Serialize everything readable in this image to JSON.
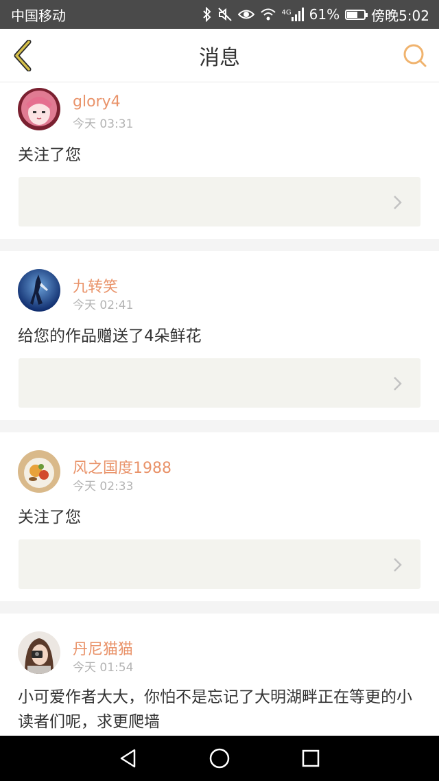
{
  "status_bar": {
    "carrier": "中国移动",
    "network": "4G",
    "battery": "61%",
    "battery_level": 0.61,
    "time": "傍晚5:02",
    "icons": [
      "bluetooth-icon",
      "mute-icon",
      "eye-icon",
      "wifi-icon",
      "signal-icon",
      "battery-icon"
    ]
  },
  "nav": {
    "title": "消息",
    "back_icon": "chevron-left-icon",
    "search_icon": "search-icon",
    "accent": "#f0b36e",
    "back_color": "#c9b43a"
  },
  "messages": [
    {
      "username": "glory4",
      "time": "今天 03:31",
      "text": "关注了您",
      "avatar": "anime-girl-avatar"
    },
    {
      "username": "九转笑",
      "time": "今天 02:41",
      "text": "给您的作品赠送了4朵鲜花",
      "avatar": "blue-figure-avatar"
    },
    {
      "username": "风之国度1988",
      "time": "今天 02:33",
      "text": "关注了您",
      "avatar": "food-plate-avatar"
    },
    {
      "username": "丹尼猫猫",
      "time": "今天 01:54",
      "text": "小可爱作者大大，你怕不是忘记了大明湖畔正在等更的小读者们呢，求更爬墙",
      "avatar": "camera-girl-avatar"
    }
  ],
  "colors": {
    "username": "#e9936a",
    "time": "#b3b3b3",
    "box_bg": "#f3f3ee",
    "separator": "#f4f4f4",
    "status_bar": "#4a4a4a"
  },
  "system_nav": {
    "buttons": [
      "back-triangle-icon",
      "home-circle-icon",
      "recents-square-icon"
    ]
  }
}
